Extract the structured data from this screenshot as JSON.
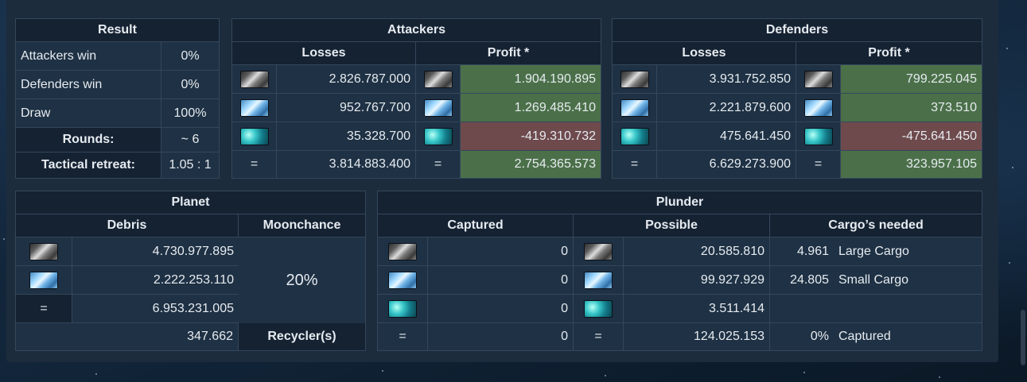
{
  "result": {
    "title": "Result",
    "rows": [
      {
        "label": "Attackers win",
        "value": "0%"
      },
      {
        "label": "Defenders win",
        "value": "0%"
      },
      {
        "label": "Draw",
        "value": "100%"
      }
    ],
    "rounds_label": "Rounds:",
    "rounds_value": "~ 6",
    "retreat_label": "Tactical retreat:",
    "retreat_value": "1.05 : 1"
  },
  "attackers": {
    "title": "Attackers",
    "losses_label": "Losses",
    "profit_label": "Profit *",
    "rows": [
      {
        "icon": "metal-icon",
        "loss": "2.826.787.000",
        "profit": "1.904.190.895",
        "profit_sign": "positive"
      },
      {
        "icon": "crystal-icon",
        "loss": "952.767.700",
        "profit": "1.269.485.410",
        "profit_sign": "positive"
      },
      {
        "icon": "deuterium-icon",
        "loss": "35.328.700",
        "profit": "-419.310.732",
        "profit_sign": "negative"
      }
    ],
    "total_symbol": "=",
    "total_loss": "3.814.883.400",
    "total_profit": "2.754.365.573"
  },
  "defenders": {
    "title": "Defenders",
    "losses_label": "Losses",
    "profit_label": "Profit *",
    "rows": [
      {
        "icon": "metal-icon",
        "loss": "3.931.752.850",
        "profit": "799.225.045",
        "profit_sign": "positive"
      },
      {
        "icon": "crystal-icon",
        "loss": "2.221.879.600",
        "profit": "373.510",
        "profit_sign": "positive"
      },
      {
        "icon": "deuterium-icon",
        "loss": "475.641.450",
        "profit": "-475.641.450",
        "profit_sign": "negative"
      }
    ],
    "total_symbol": "=",
    "total_loss": "6.629.273.900",
    "total_profit": "323.957.105"
  },
  "planet": {
    "title": "Planet",
    "debris_label": "Debris",
    "moonchance_label": "Moonchance",
    "moonchance_value": "20%",
    "debris_rows": [
      {
        "icon": "metal-icon",
        "value": "4.730.977.895"
      },
      {
        "icon": "crystal-icon",
        "value": "2.222.253.110"
      }
    ],
    "total_symbol": "=",
    "total_value": "6.953.231.005",
    "recyclers_count": "347.662",
    "recyclers_label": "Recycler(s)"
  },
  "plunder": {
    "title": "Plunder",
    "captured_label": "Captured",
    "possible_label": "Possible",
    "cargo_label": "Cargo’s needed",
    "rows": [
      {
        "icon": "metal-icon",
        "captured": "0",
        "possible": "20.585.810",
        "cargo_count": "4.961",
        "cargo_type": "Large Cargo"
      },
      {
        "icon": "crystal-icon",
        "captured": "0",
        "possible": "99.927.929",
        "cargo_count": "24.805",
        "cargo_type": "Small Cargo"
      },
      {
        "icon": "deuterium-icon",
        "captured": "0",
        "possible": "3.511.414",
        "cargo_count": "",
        "cargo_type": ""
      }
    ],
    "total_symbol": "=",
    "total_captured": "0",
    "total_possible": "124.025.153",
    "total_pct": "0%",
    "total_pct_label": "Captured"
  },
  "colors": {
    "positive": "#4b7049",
    "negative": "#6e4a4d",
    "header_bg": "#152232",
    "cell_bg": "#1f3144"
  }
}
